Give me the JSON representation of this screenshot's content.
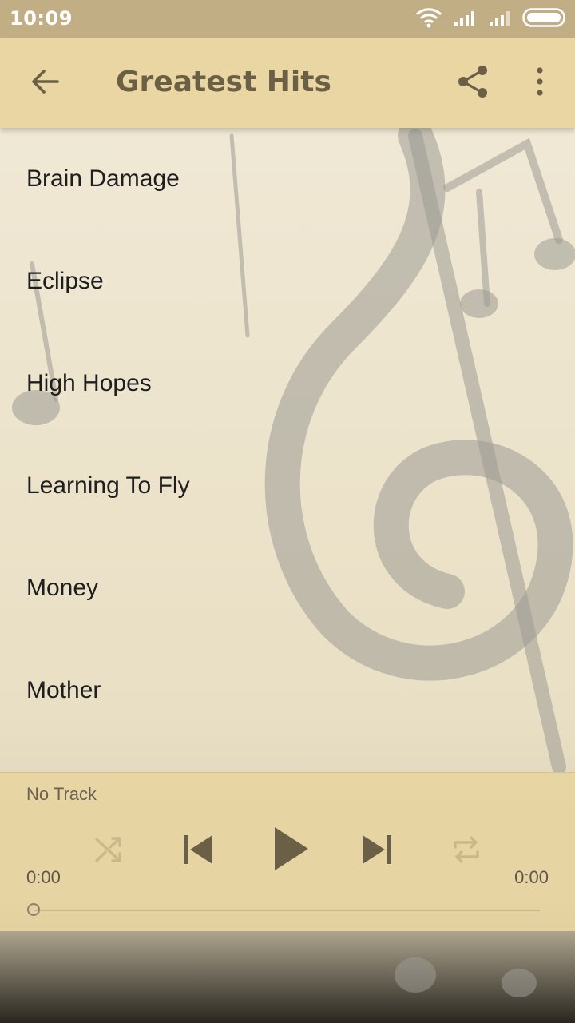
{
  "status_bar": {
    "time": "10:09"
  },
  "app_bar": {
    "title": "Greatest Hits"
  },
  "tracks": [
    {
      "title": "Brain Damage"
    },
    {
      "title": "Eclipse"
    },
    {
      "title": "High Hopes"
    },
    {
      "title": "Learning To Fly"
    },
    {
      "title": "Money"
    },
    {
      "title": "Mother"
    }
  ],
  "player": {
    "now_playing": "No Track",
    "elapsed": "0:00",
    "duration": "0:00",
    "progress": 0
  },
  "colors": {
    "status_bar": "#c2ae85",
    "app_bar": "#ead6a3",
    "accent_text": "#6b5f45",
    "control_icon": "#6b5f45",
    "disabled_icon": "#cbb888"
  },
  "icons": [
    "wifi-icon",
    "signal-icon",
    "battery-icon",
    "back-arrow-icon",
    "share-icon",
    "more-vert-icon",
    "shuffle-icon",
    "skip-previous-icon",
    "play-icon",
    "skip-next-icon",
    "repeat-icon"
  ]
}
